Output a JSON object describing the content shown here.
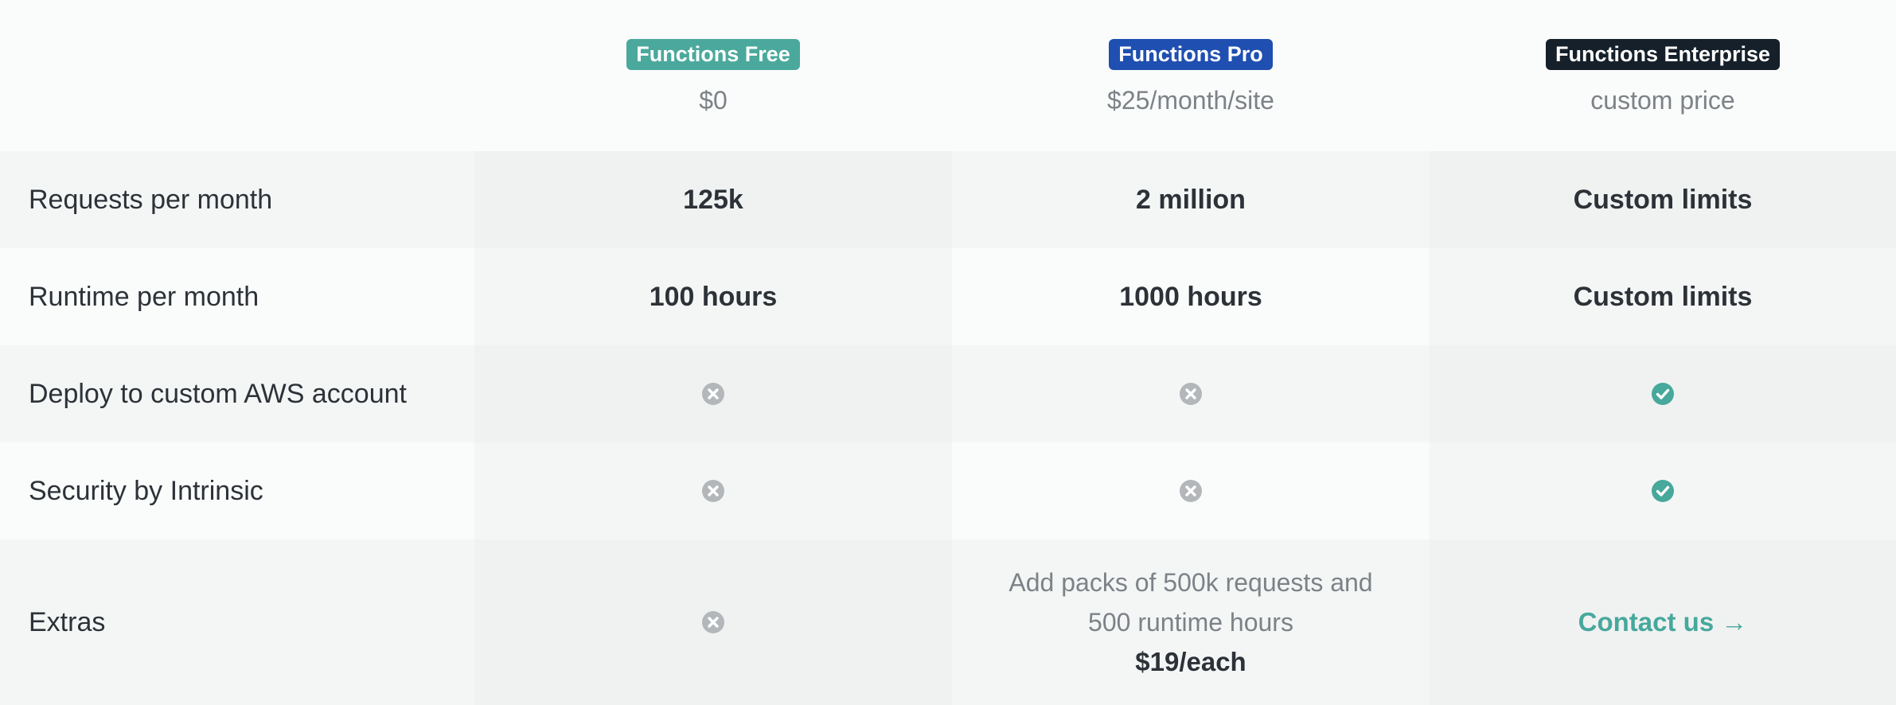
{
  "plans": [
    {
      "name": "Functions Free",
      "price": "$0",
      "color": "#4aa99c"
    },
    {
      "name": "Functions Pro",
      "price": "$25/month/site",
      "color": "#1f4fb0"
    },
    {
      "name": "Functions Enterprise",
      "price": "custom price",
      "color": "#15202a"
    }
  ],
  "rows": [
    {
      "label": "Requests per month",
      "values": [
        "125k",
        "2 million",
        "Custom limits"
      ]
    },
    {
      "label": "Runtime per month",
      "values": [
        "100 hours",
        "1000 hours",
        "Custom limits"
      ]
    },
    {
      "label": "Deploy to custom AWS account",
      "values": [
        "x-circle-icon",
        "x-circle-icon",
        "check-circle-icon"
      ]
    },
    {
      "label": "Security by Intrinsic",
      "values": [
        "x-circle-icon",
        "x-circle-icon",
        "check-circle-icon"
      ]
    },
    {
      "label": "Extras",
      "free": "x-circle-icon",
      "pro_desc_line1": "Add packs of 500k requests and",
      "pro_desc_line2": "500 runtime hours",
      "pro_price": "$19/each",
      "enterprise_link": "Contact us →"
    }
  ],
  "colors": {
    "check": "#47a89c",
    "x": "#b3b7ba",
    "link": "#47a89c"
  }
}
